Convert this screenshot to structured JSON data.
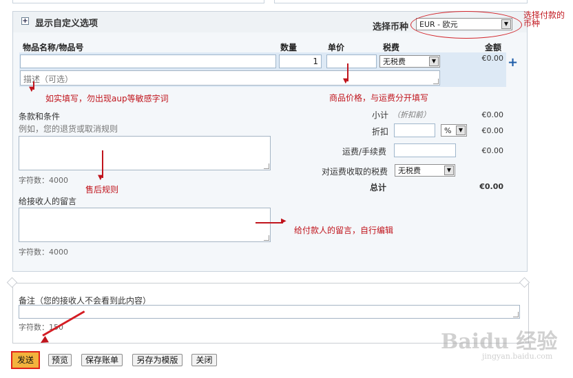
{
  "header": {
    "expand_symbol": "+",
    "title": "显示自定义选项",
    "currency_label": "选择币种",
    "currency_value": "EUR - 欧元"
  },
  "columns": {
    "item": "物品名称/物品号",
    "qty": "数量",
    "price": "单价",
    "tax": "税费",
    "amount": "金额"
  },
  "item_row": {
    "name_value": "",
    "qty_value": "1",
    "price_value": "",
    "tax_value": "无税费",
    "amount": "€0.00",
    "description_placeholder": "描述（可选）",
    "add_symbol": "+"
  },
  "terms": {
    "title": "条款和条件",
    "hint": "例如，您的退货或取消规则",
    "char_count": "字符数：4000"
  },
  "message": {
    "title": "给接收人的留言",
    "char_count": "字符数：4000"
  },
  "summary": {
    "subtotal_label": "小计",
    "subtotal_note": "（折扣前）",
    "subtotal_value": "€0.00",
    "discount_label": "折扣",
    "discount_unit": "%",
    "discount_value": "€0.00",
    "shipping_label": "运费/手续费",
    "shipping_value": "€0.00",
    "shipping_tax_label": "对运费收取的税费",
    "shipping_tax_value": "无税费",
    "total_label": "总计",
    "total_value": "€0.00"
  },
  "notes": {
    "label": "备注（您的接收人不会看到此内容）",
    "char_count": "字符数：150"
  },
  "buttons": {
    "send": "发送",
    "preview": "预览",
    "save_invoice": "保存账单",
    "save_template": "另存为模版",
    "close": "关闭"
  },
  "annotations": {
    "currency": "选择付款的币种",
    "description": "如实填写，勿出现aup等敏感字词",
    "price": "商品价格，与运费分开填写",
    "terms": "售后规则",
    "message": "给付款人的留言，自行编辑"
  },
  "watermark": {
    "brand": "Baidu 经验",
    "url": "jingyan.baidu.com"
  },
  "colors": {
    "annotation_red": "#c0141c",
    "send_button": "#f3b33d",
    "panel_bg": "#f4f7fa",
    "item_row_bg": "#dde9f5"
  }
}
